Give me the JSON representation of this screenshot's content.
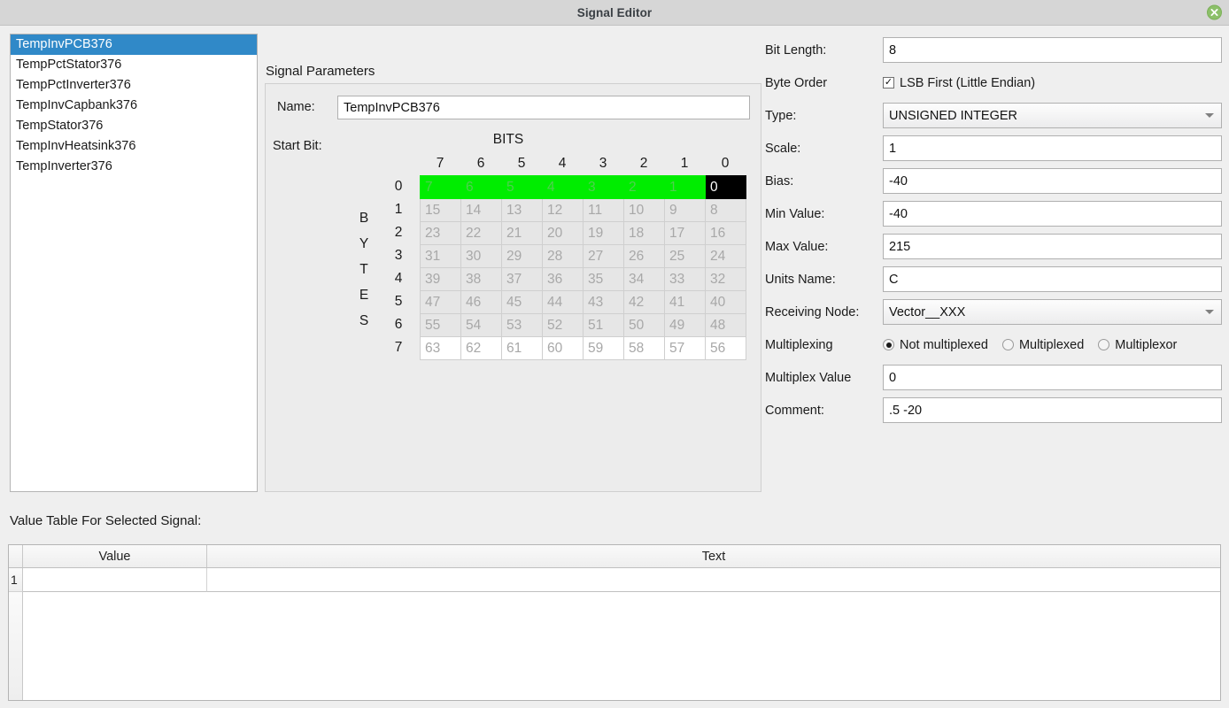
{
  "window": {
    "title": "Signal Editor",
    "close_label": "×"
  },
  "signal_list": {
    "items": [
      {
        "label": "TempInvPCB376",
        "selected": true
      },
      {
        "label": "TempPctStator376",
        "selected": false
      },
      {
        "label": "TempPctInverter376",
        "selected": false
      },
      {
        "label": "TempInvCapbank376",
        "selected": false
      },
      {
        "label": "TempStator376",
        "selected": false
      },
      {
        "label": "TempInvHeatsink376",
        "selected": false
      },
      {
        "label": "TempInverter376",
        "selected": false
      }
    ]
  },
  "signal_parameters": {
    "group_title": "Signal Parameters",
    "name_label": "Name:",
    "name_value": "TempInvPCB376",
    "start_bit_label": "Start Bit:",
    "bits_title": "BITS",
    "bytes_title": "BYTES",
    "bytes_letters": [
      "B",
      "Y",
      "T",
      "E",
      "S"
    ],
    "column_headers": [
      "7",
      "6",
      "5",
      "4",
      "3",
      "2",
      "1",
      "0"
    ],
    "row_headers": [
      "0",
      "1",
      "2",
      "3",
      "4",
      "5",
      "6",
      "7"
    ],
    "grid_rows": [
      {
        "cells": [
          "7",
          "6",
          "5",
          "4",
          "3",
          "2",
          "1",
          "0"
        ],
        "states": [
          "on",
          "on",
          "on",
          "on",
          "on",
          "on",
          "on",
          "start"
        ]
      },
      {
        "cells": [
          "15",
          "14",
          "13",
          "12",
          "11",
          "10",
          "9",
          "8"
        ],
        "states": [
          "off",
          "off",
          "off",
          "off",
          "off",
          "off",
          "off",
          "off"
        ]
      },
      {
        "cells": [
          "23",
          "22",
          "21",
          "20",
          "19",
          "18",
          "17",
          "16"
        ],
        "states": [
          "off",
          "off",
          "off",
          "off",
          "off",
          "off",
          "off",
          "off"
        ]
      },
      {
        "cells": [
          "31",
          "30",
          "29",
          "28",
          "27",
          "26",
          "25",
          "24"
        ],
        "states": [
          "off",
          "off",
          "off",
          "off",
          "off",
          "off",
          "off",
          "off"
        ]
      },
      {
        "cells": [
          "39",
          "38",
          "37",
          "36",
          "35",
          "34",
          "33",
          "32"
        ],
        "states": [
          "off",
          "off",
          "off",
          "off",
          "off",
          "off",
          "off",
          "off"
        ]
      },
      {
        "cells": [
          "47",
          "46",
          "45",
          "44",
          "43",
          "42",
          "41",
          "40"
        ],
        "states": [
          "off",
          "off",
          "off",
          "off",
          "off",
          "off",
          "off",
          "off"
        ]
      },
      {
        "cells": [
          "55",
          "54",
          "53",
          "52",
          "51",
          "50",
          "49",
          "48"
        ],
        "states": [
          "off",
          "off",
          "off",
          "off",
          "off",
          "off",
          "off",
          "off"
        ]
      },
      {
        "cells": [
          "63",
          "62",
          "61",
          "60",
          "59",
          "58",
          "57",
          "56"
        ],
        "states": [
          "off",
          "off",
          "off",
          "off",
          "off",
          "off",
          "off",
          "off"
        ]
      }
    ]
  },
  "params": {
    "bit_length_label": "Bit Length:",
    "bit_length_value": "8",
    "byte_order_label": "Byte Order",
    "byte_order_checkbox_label": "LSB First (Little Endian)",
    "byte_order_checked": true,
    "check_glyph": "✓",
    "type_label": "Type:",
    "type_value": "UNSIGNED INTEGER",
    "scale_label": "Scale:",
    "scale_value": "1",
    "bias_label": "Bias:",
    "bias_value": "-40",
    "min_value_label": "Min Value:",
    "min_value_value": "-40",
    "max_value_label": "Max Value:",
    "max_value_value": "215",
    "units_name_label": "Units Name:",
    "units_name_value": "C",
    "receiving_node_label": "Receiving Node:",
    "receiving_node_value": "Vector__XXX",
    "multiplexing_label": "Multiplexing",
    "multiplex_options": [
      {
        "label": "Not multiplexed",
        "selected": true
      },
      {
        "label": "Multiplexed",
        "selected": false
      },
      {
        "label": "Multiplexor",
        "selected": false
      }
    ],
    "multiplex_value_label": "Multiplex Value",
    "multiplex_value_value": "0",
    "comment_label": "Comment:",
    "comment_value": ".5 -20"
  },
  "value_table": {
    "title": "Value Table For Selected Signal:",
    "columns": [
      "Value",
      "Text"
    ],
    "rows": [
      {
        "index": "1",
        "value": "",
        "text": ""
      }
    ]
  },
  "colors": {
    "selection_blue": "#3089c8",
    "bit_on_green": "#00ed00",
    "bit_start_black": "#000000",
    "window_bg": "#efefef",
    "titlebar_bg": "#d6d6d6",
    "close_green": "#8cc069"
  }
}
